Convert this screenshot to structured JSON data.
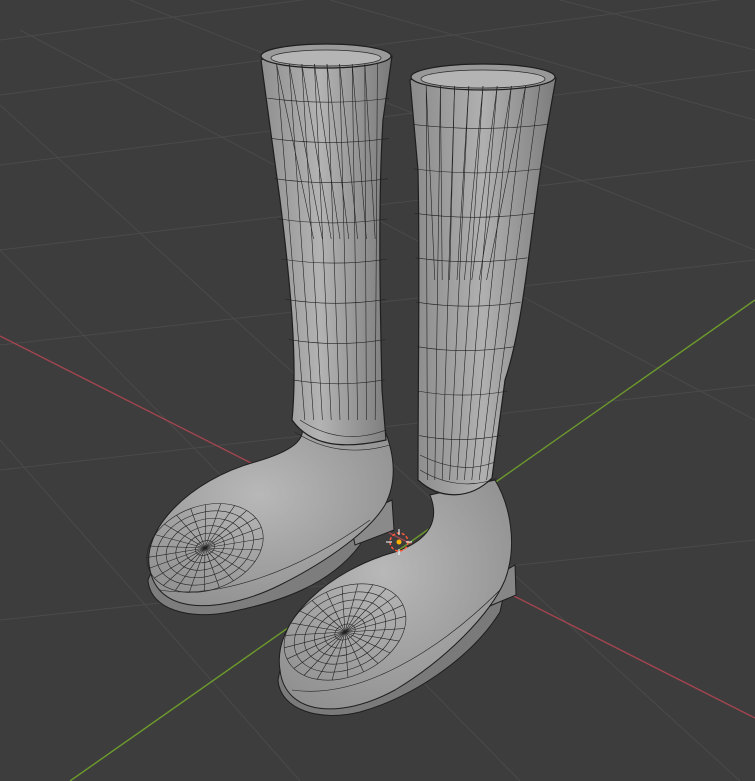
{
  "viewport": {
    "mode": "3d-viewport-wireframe-overlay",
    "background_color": "#3d3d3d",
    "grid_color": "#4a4a4a",
    "x_axis_color": "#a3454f",
    "y_axis_color": "#6d9a2c",
    "mesh_color": "#a9a9a9",
    "wire_color": "#1e1e1e",
    "origin_marker_color": "#ff5a3c"
  },
  "scene": {
    "objects": [
      {
        "name": "left-boot",
        "icon": "mesh-object"
      },
      {
        "name": "right-boot",
        "icon": "mesh-object"
      }
    ],
    "origin_marker_icon": "object-origin-icon"
  }
}
